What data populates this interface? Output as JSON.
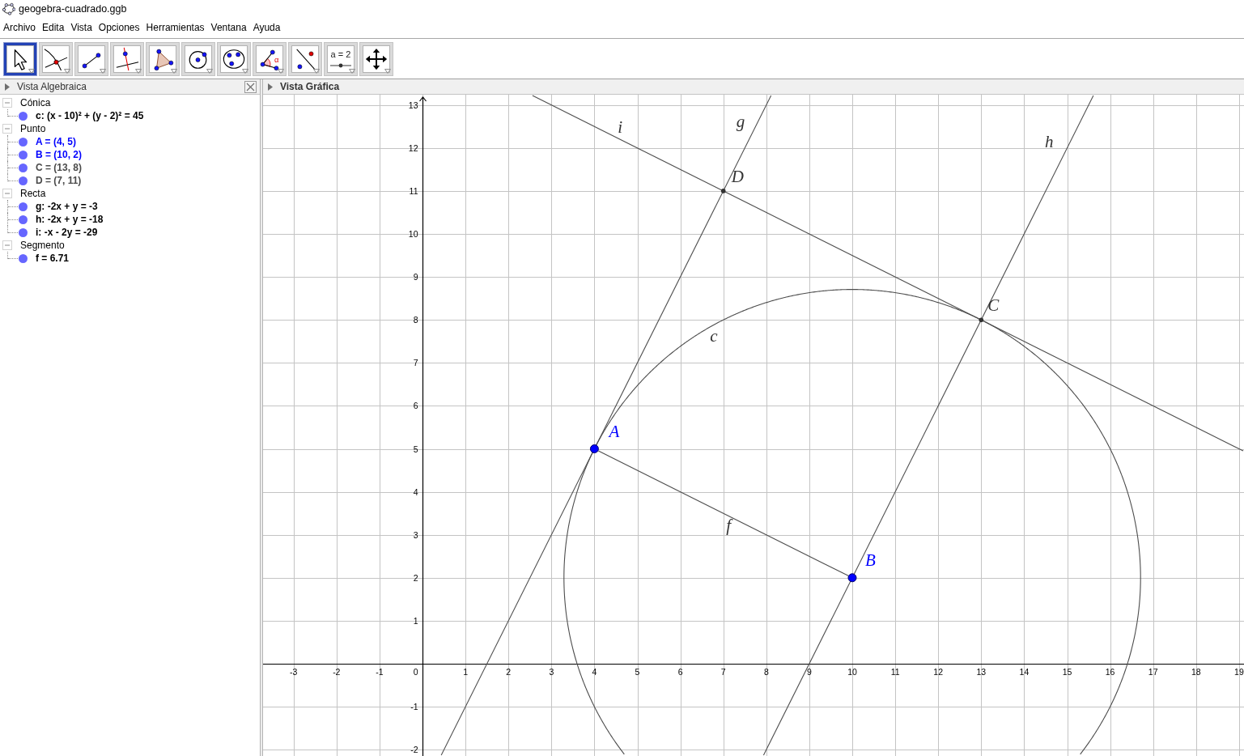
{
  "window": {
    "title": "geogebra-cuadrado.ggb"
  },
  "menu": [
    "Archivo",
    "Edita",
    "Vista",
    "Opciones",
    "Herramientas",
    "Ventana",
    "Ayuda"
  ],
  "toolbar": [
    {
      "kind": "move",
      "selected": true
    },
    {
      "kind": "intersect",
      "selected": false
    },
    {
      "kind": "segment",
      "selected": false
    },
    {
      "kind": "perpendicular",
      "selected": false
    },
    {
      "kind": "polygon",
      "selected": false
    },
    {
      "kind": "circle",
      "selected": false
    },
    {
      "kind": "circle3",
      "selected": false
    },
    {
      "kind": "angle",
      "selected": false,
      "text": "α"
    },
    {
      "kind": "reflect",
      "selected": false
    },
    {
      "kind": "slider",
      "selected": false,
      "text": "a = 2"
    },
    {
      "kind": "pan",
      "selected": false
    }
  ],
  "algebra_view": {
    "title": "Vista Algebraica",
    "focused": false,
    "groups": [
      {
        "label": "Cónica",
        "expanded": true,
        "children": [
          {
            "text": "c: (x - 10)² + (y - 2)² = 45",
            "color": "#000000",
            "visible": true
          }
        ]
      },
      {
        "label": "Punto",
        "expanded": true,
        "children": [
          {
            "text": "A = (4, 5)",
            "color": "#0000ff",
            "visible": true
          },
          {
            "text": "B = (10, 2)",
            "color": "#0000ff",
            "visible": true
          },
          {
            "text": "C = (13, 8)",
            "color": "#4a4a4a",
            "visible": true
          },
          {
            "text": "D = (7, 11)",
            "color": "#4a4a4a",
            "visible": true
          }
        ]
      },
      {
        "label": "Recta",
        "expanded": true,
        "children": [
          {
            "text": "g: -2x + y = -3",
            "color": "#000000",
            "visible": true
          },
          {
            "text": "h: -2x + y = -18",
            "color": "#000000",
            "visible": true
          },
          {
            "text": "i: -x - 2y = -29",
            "color": "#000000",
            "visible": true
          }
        ]
      },
      {
        "label": "Segmento",
        "expanded": true,
        "children": [
          {
            "text": "f = 6.71",
            "color": "#000000",
            "visible": true
          }
        ]
      }
    ]
  },
  "graphics_view": {
    "title": "Vista Gráfica",
    "focused": true,
    "x_axis": {
      "labels": [
        "-3",
        "-2",
        "-1",
        "1",
        "2",
        "3",
        "4",
        "5",
        "6",
        "7",
        "8",
        "9",
        "10",
        "11",
        "12",
        "13",
        "14",
        "15",
        "16",
        "17",
        "18",
        "19"
      ]
    },
    "y_axis": {
      "labels": [
        "13",
        "12",
        "11",
        "10",
        "9",
        "8",
        "7",
        "6",
        "5",
        "4",
        "3",
        "2",
        "1",
        "-1",
        "-2"
      ]
    },
    "origin_label": "0",
    "objects": [
      {
        "kind": "line",
        "label": "i"
      },
      {
        "kind": "line",
        "label": "g"
      },
      {
        "kind": "line",
        "label": "h"
      },
      {
        "kind": "point",
        "label": "D",
        "color": "#333333"
      },
      {
        "kind": "point",
        "label": "C",
        "color": "#333333"
      },
      {
        "kind": "circle",
        "label": "c"
      },
      {
        "kind": "freepoint",
        "label": "A",
        "color": "#0000ff"
      },
      {
        "kind": "segment",
        "label": "f"
      },
      {
        "kind": "freepoint",
        "label": "B",
        "color": "#0000ff"
      }
    ]
  }
}
